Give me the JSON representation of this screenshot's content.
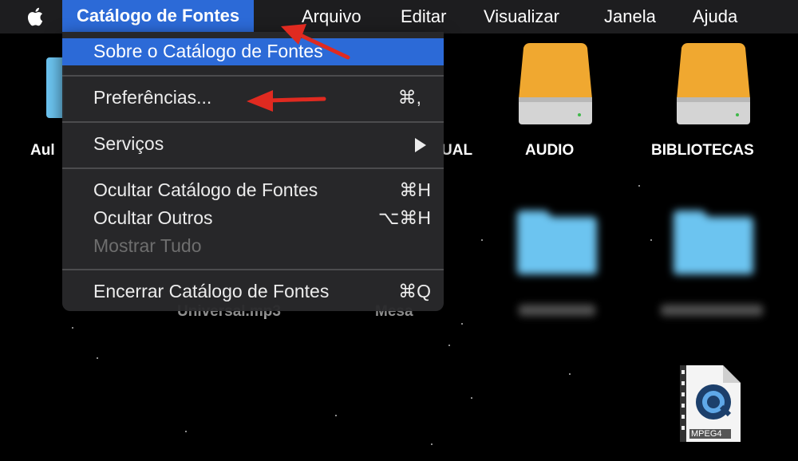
{
  "menubar": {
    "app_name": "Catálogo de Fontes",
    "items": [
      "Arquivo",
      "Editar",
      "Visualizar",
      "Janela",
      "Ajuda"
    ]
  },
  "dropdown": {
    "about": "Sobre o Catálogo de Fontes",
    "preferences": "Preferências...",
    "preferences_shortcut": "⌘,",
    "services": "Serviços",
    "hide_app": "Ocultar Catálogo de Fontes",
    "hide_app_shortcut": "⌘H",
    "hide_others": "Ocultar Outros",
    "hide_others_shortcut": "⌥⌘H",
    "show_all": "Mostrar Tudo",
    "quit": "Encerrar Catálogo de Fontes",
    "quit_shortcut": "⌘Q"
  },
  "desktop": {
    "aula_label_partial": "Aul",
    "manual_label_partial": "UAL",
    "audio_label": "AUDIO",
    "bibliotecas_label": "BIBLIOTECAS",
    "universal_label_partial": "Universal.mp3",
    "mesa_label_partial": "Mesa",
    "mpeg4_badge": "MPEG4"
  },
  "colors": {
    "menubar_bg": "#1d1d1f",
    "highlight": "#2c6ad7",
    "annotation_arrow": "#e02a20",
    "drive_orange": "#f0a830",
    "folder_blue": "#6cc4f0"
  }
}
